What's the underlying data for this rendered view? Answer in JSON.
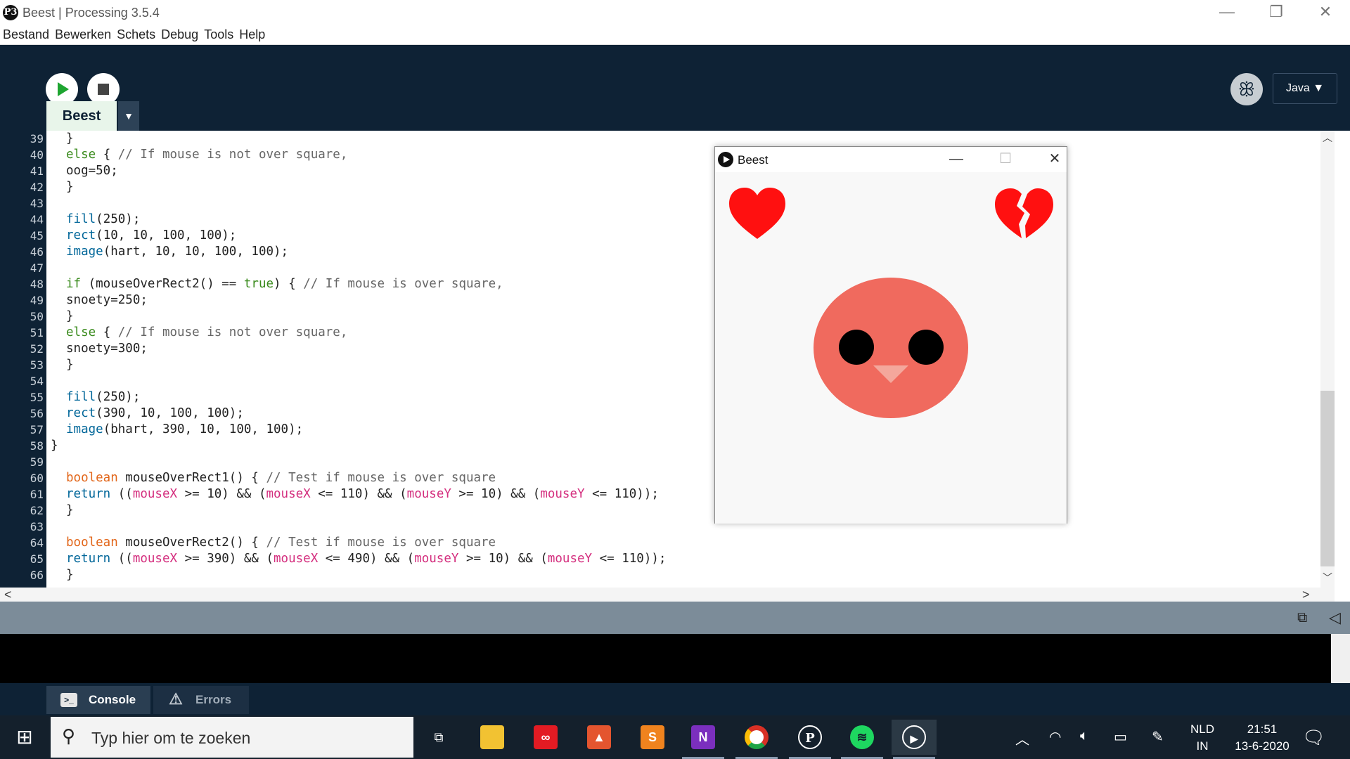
{
  "window": {
    "logo": "P3",
    "title": "Beest | Processing 3.5.4",
    "controls": {
      "minimize": "—",
      "restore": "❐",
      "close": "✕"
    }
  },
  "menu": [
    "Bestand",
    "Bewerken",
    "Schets",
    "Debug",
    "Tools",
    "Help"
  ],
  "toolbar": {
    "mode": "Java ▼",
    "debug_icon": "butterfly-icon",
    "tab_name": "Beest",
    "tab_menu": "▼"
  },
  "editor": {
    "line_numbers": [
      "39",
      "40",
      "41",
      "42",
      "43",
      "44",
      "45",
      "46",
      "47",
      "48",
      "49",
      "50",
      "51",
      "52",
      "53",
      "54",
      "55",
      "56",
      "57",
      "58",
      "59",
      "60",
      "61",
      "62",
      "63",
      "64",
      "65",
      "66"
    ],
    "lines": [
      [
        {
          "t": "}",
          "c": ""
        }
      ],
      [
        {
          "t": "else",
          "c": "kw"
        },
        {
          "t": " { ",
          "c": ""
        },
        {
          "t": "// If mouse is not over square,",
          "c": "cm"
        }
      ],
      [
        {
          "t": "oog=50;",
          "c": ""
        }
      ],
      [
        {
          "t": "}",
          "c": ""
        }
      ],
      [],
      [
        {
          "t": "fill",
          "c": "fn"
        },
        {
          "t": "(250);",
          "c": ""
        }
      ],
      [
        {
          "t": "rect",
          "c": "fn"
        },
        {
          "t": "(10, 10, 100, 100);",
          "c": ""
        }
      ],
      [
        {
          "t": "image",
          "c": "fn"
        },
        {
          "t": "(hart, 10, 10, 100, 100);",
          "c": ""
        }
      ],
      [],
      [
        {
          "t": "if",
          "c": "kw"
        },
        {
          "t": " (mouseOverRect2() == ",
          "c": ""
        },
        {
          "t": "true",
          "c": "kw"
        },
        {
          "t": ") { ",
          "c": ""
        },
        {
          "t": "// If mouse is over square,",
          "c": "cm"
        }
      ],
      [
        {
          "t": "snoety=250;",
          "c": ""
        }
      ],
      [
        {
          "t": "}",
          "c": ""
        }
      ],
      [
        {
          "t": "else",
          "c": "kw"
        },
        {
          "t": " { ",
          "c": ""
        },
        {
          "t": "// If mouse is not over square,",
          "c": "cm"
        }
      ],
      [
        {
          "t": "snoety=300;",
          "c": ""
        }
      ],
      [
        {
          "t": "}",
          "c": ""
        }
      ],
      [],
      [
        {
          "t": "fill",
          "c": "fn"
        },
        {
          "t": "(250);",
          "c": ""
        }
      ],
      [
        {
          "t": "rect",
          "c": "fn"
        },
        {
          "t": "(390, 10, 100, 100);",
          "c": ""
        }
      ],
      [
        {
          "t": "image",
          "c": "fn"
        },
        {
          "t": "(bhart, 390, 10, 100, 100);",
          "c": ""
        }
      ],
      [
        {
          "t": "}",
          "c": ""
        }
      ],
      [],
      [
        {
          "t": "boolean",
          "c": "kw2"
        },
        {
          "t": " mouseOverRect1() { ",
          "c": ""
        },
        {
          "t": "// Test if mouse is over square",
          "c": "cm"
        }
      ],
      [
        {
          "t": "return",
          "c": "fn"
        },
        {
          "t": " ((",
          "c": ""
        },
        {
          "t": "mouseX",
          "c": "vr"
        },
        {
          "t": " >= 10) && (",
          "c": ""
        },
        {
          "t": "mouseX",
          "c": "vr"
        },
        {
          "t": " <= 110) && (",
          "c": ""
        },
        {
          "t": "mouseY",
          "c": "vr"
        },
        {
          "t": " >= 10) && (",
          "c": ""
        },
        {
          "t": "mouseY",
          "c": "vr"
        },
        {
          "t": " <= 110));",
          "c": ""
        }
      ],
      [
        {
          "t": "}",
          "c": ""
        }
      ],
      [],
      [
        {
          "t": "boolean",
          "c": "kw2"
        },
        {
          "t": " mouseOverRect2() { ",
          "c": ""
        },
        {
          "t": "// Test if mouse is over square",
          "c": "cm"
        }
      ],
      [
        {
          "t": "return",
          "c": "fn"
        },
        {
          "t": " ((",
          "c": ""
        },
        {
          "t": "mouseX",
          "c": "vr"
        },
        {
          "t": " >= 390) && (",
          "c": ""
        },
        {
          "t": "mouseX",
          "c": "vr"
        },
        {
          "t": " <= 490) && (",
          "c": ""
        },
        {
          "t": "mouseY",
          "c": "vr"
        },
        {
          "t": " >= 10) && (",
          "c": ""
        },
        {
          "t": "mouseY",
          "c": "vr"
        },
        {
          "t": " <= 110));",
          "c": ""
        }
      ],
      [
        {
          "t": "}",
          "c": ""
        }
      ]
    ],
    "indented": [
      true,
      true,
      true,
      true,
      false,
      true,
      true,
      true,
      false,
      true,
      true,
      true,
      true,
      true,
      true,
      false,
      true,
      true,
      true,
      false,
      false,
      true,
      true,
      true,
      false,
      true,
      true,
      true
    ]
  },
  "console": {
    "tabs": [
      {
        "label": "Console",
        "icon": "console-icon",
        "glyph": ">_"
      },
      {
        "label": "Errors",
        "icon": "warning-icon",
        "glyph": "⚠"
      }
    ]
  },
  "sketch": {
    "title": "Beest",
    "controls": {
      "minimize": "—",
      "maximize": "☐",
      "close": "✕"
    },
    "colors": {
      "heart": "#ff1010",
      "face": "#f06a5e",
      "beak": "#f4a79c",
      "background": "#f8f8f8"
    }
  },
  "taskbar": {
    "search_placeholder": "Typ hier om te zoeken",
    "apps": [
      "task-view-icon",
      "file-explorer-icon",
      "creative-cloud-icon",
      "app-red-icon",
      "sublime-icon",
      "onenote-icon",
      "chrome-icon",
      "processing-icon",
      "spotify-icon",
      "sketch-running-icon"
    ],
    "lang": [
      "NLD",
      "IN"
    ],
    "time": "21:51",
    "date": "13-6-2020"
  }
}
